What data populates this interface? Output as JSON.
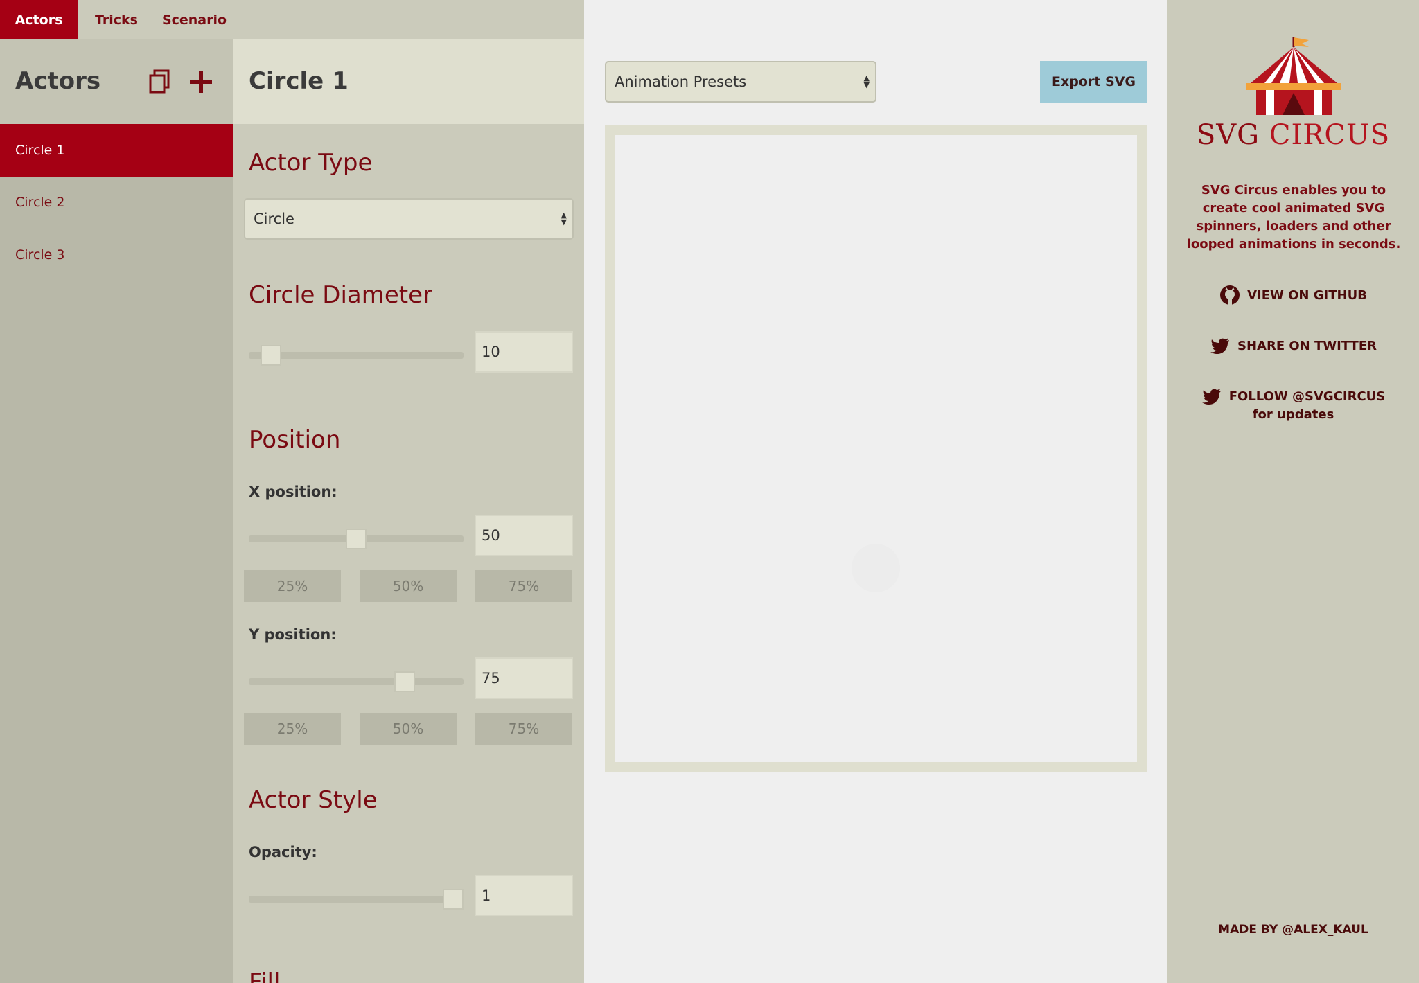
{
  "tabs": [
    {
      "label": "Actors"
    },
    {
      "label": "Tricks"
    },
    {
      "label": "Scenario"
    }
  ],
  "actors_panel": {
    "title": "Actors",
    "duplicate_icon": "duplicate-icon",
    "add_icon": "plus-icon",
    "items": [
      {
        "label": "Circle 1"
      },
      {
        "label": "Circle 2"
      },
      {
        "label": "Circle 3"
      }
    ]
  },
  "editor": {
    "title": "Circle 1",
    "actor_type": {
      "heading": "Actor Type",
      "selected": "Circle"
    },
    "diameter": {
      "heading": "Circle Diameter",
      "value": "10",
      "slider_fraction": 0.06
    },
    "position": {
      "heading": "Position",
      "x_label": "X position:",
      "x_value": "50",
      "x_slider_fraction": 0.5,
      "y_label": "Y position:",
      "y_value": "75",
      "y_slider_fraction": 0.75,
      "presets": [
        "25%",
        "50%",
        "75%"
      ]
    },
    "style": {
      "heading": "Actor Style",
      "opacity_label": "Opacity:",
      "opacity_value": "1",
      "opacity_slider_fraction": 1.0
    },
    "fill_heading": "Fill"
  },
  "canvas": {
    "presets_select": "Animation Presets",
    "export_label": "Export SVG"
  },
  "info": {
    "logo_word1": "SVG",
    "logo_word2": "CIRCUS",
    "tagline": "SVG Circus enables you to create cool animated SVG spinners, loaders and other looped animations in seconds.",
    "github_label": "VIEW ON GITHUB",
    "twitter_label": "SHARE ON TWITTER",
    "follow_label": "FOLLOW @SVGCIRCUS",
    "follow_sub": "for updates",
    "made_by": "MADE BY @ALEX_KAUL"
  },
  "colors": {
    "accent": "#a50014",
    "text_accent": "#7a0a12",
    "export_button": "#9ecbd8"
  }
}
